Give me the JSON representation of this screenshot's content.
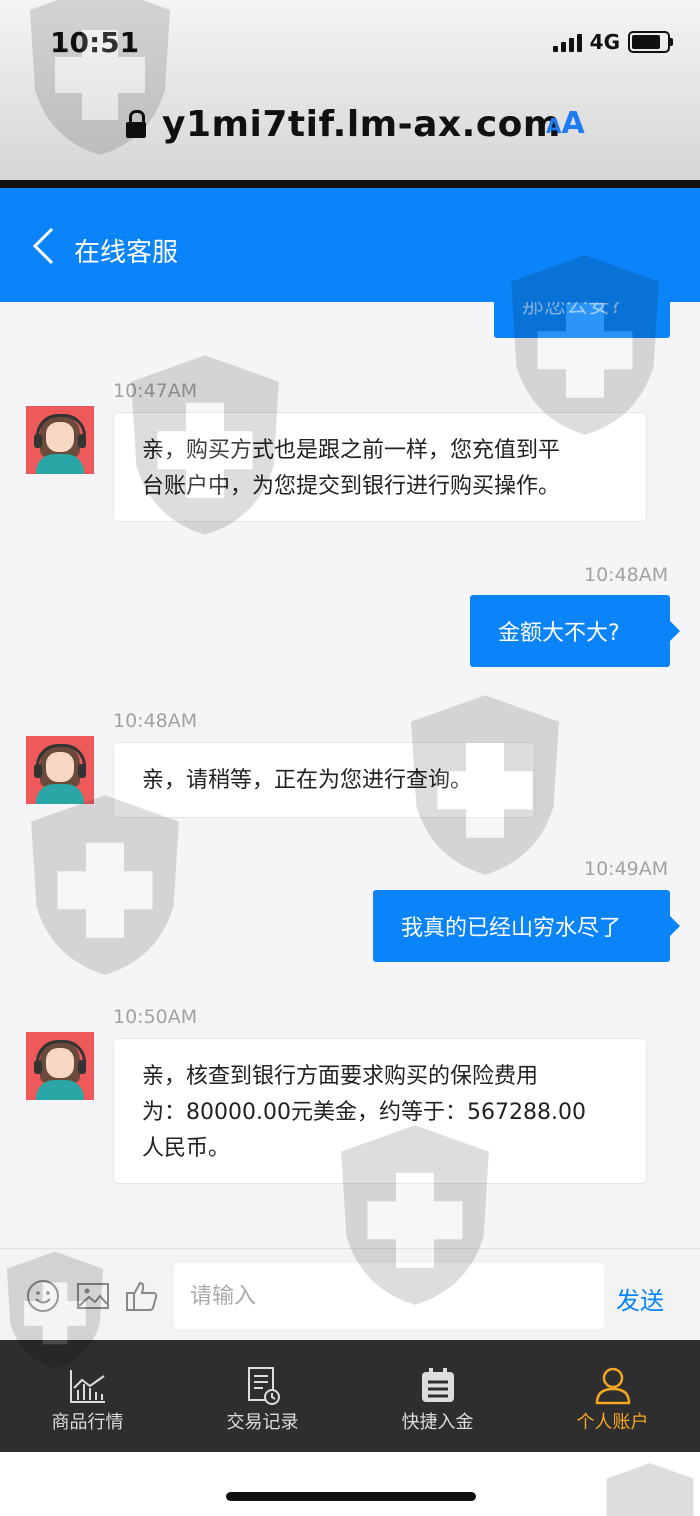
{
  "status": {
    "time": "10:51",
    "network": "4G"
  },
  "browser": {
    "url": "y1mi7tif.lm-ax.com",
    "text_size_small": "A",
    "text_size_large": "A"
  },
  "header": {
    "title": "在线客服"
  },
  "chat": {
    "partial_message": "那您公安?",
    "messages": [
      {
        "time": "10:47AM",
        "text_line1": "亲，购买方式也是跟之前一样，您充值到平",
        "text_line2": "台账户中，为您提交到银行进行购买操作。"
      },
      {
        "time": "10:48AM",
        "text": "金额大不大?"
      },
      {
        "time": "10:48AM",
        "text": "亲，请稍等，正在为您进行查询。"
      },
      {
        "time": "10:49AM",
        "text": "我真的已经山穷水尽了"
      },
      {
        "time": "10:50AM",
        "text_line1": "亲，核查到银行方面要求购买的保险费用",
        "text_line2": "为：80000.00元美金，约等于：567288.00",
        "text_line3": "人民币。"
      }
    ]
  },
  "input": {
    "placeholder": "请输入",
    "send_label": "发送"
  },
  "tabs": [
    {
      "label": "商品行情",
      "icon": "chart-icon"
    },
    {
      "label": "交易记录",
      "icon": "record-icon"
    },
    {
      "label": "快捷入金",
      "icon": "calendar-icon"
    },
    {
      "label": "个人账户",
      "icon": "user-icon"
    }
  ],
  "colors": {
    "accent": "#0a84f8",
    "tab_active": "#f5a623",
    "tabbar": "#2e2e2e"
  }
}
